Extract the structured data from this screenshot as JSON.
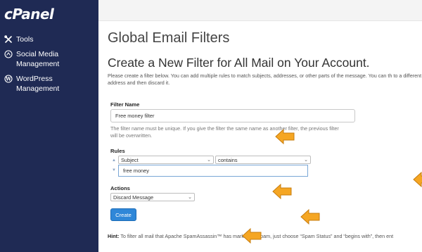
{
  "sidebar": {
    "logo": "cPanel",
    "items": [
      {
        "label": "Tools",
        "icon": "tools-icon"
      },
      {
        "label": "Social Media\nManagement",
        "icon": "social-media-icon"
      },
      {
        "label": "WordPress\nManagement",
        "icon": "wordpress-icon"
      }
    ]
  },
  "main": {
    "page_title": "Global Email Filters",
    "section_title": "Create a New Filter for All Mail on Your Account.",
    "intro": "Please create a filter below. You can add multiple rules to match subjects, addresses, or other parts of the message. You can th to a different address and then discard it.",
    "filter_name_label": "Filter Name",
    "filter_name_value": "Free money filter",
    "filter_name_help": "The filter name must be unique. If you give the filter the same name as another filter, the previous filter will be overwritten.",
    "rules_label": "Rules",
    "rule_field": "Subject",
    "rule_operator": "contains",
    "rule_value": "free money",
    "actions_label": "Actions",
    "action_value": "Discard Message",
    "create_label": "Create",
    "hint_label": "Hint:",
    "hint_text": " To filter all mail that Apache SpamAssassin™ has marked as spam, just choose “Spam Status” and “begins with”, then ent"
  },
  "colors": {
    "sidebar_bg": "#1f2a54",
    "button_bg": "#2f87d8",
    "arrow": "#f5a623"
  }
}
